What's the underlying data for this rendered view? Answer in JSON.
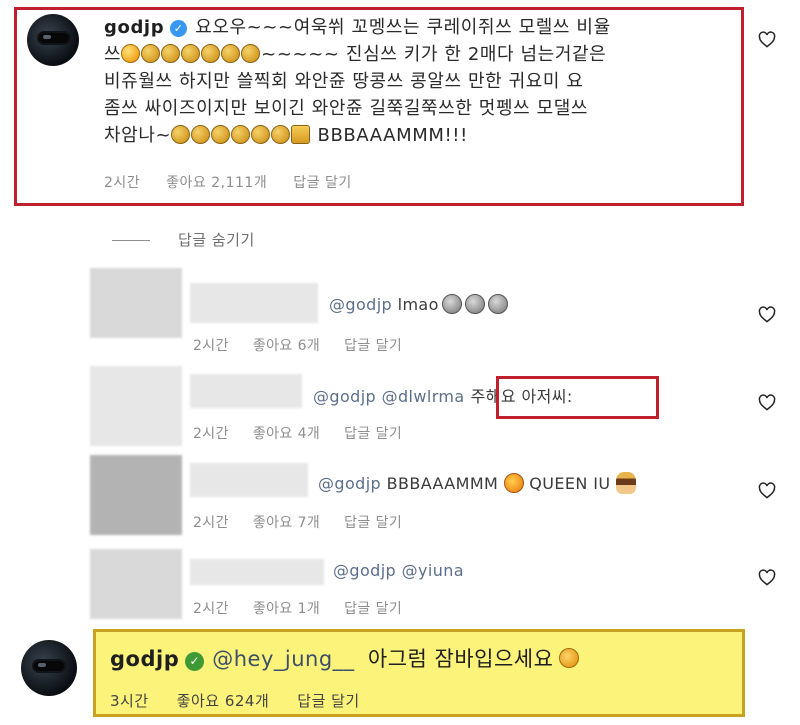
{
  "top_comment": {
    "username": "godjp",
    "line1": "요오우~~~여욱쒸 꼬멩쓰는 쿠레이쥐쓰 모렐쓰 비율",
    "line2_prefix": "쓰",
    "line2_suffix": "~~~~~ 진심쓰 키가 한 2매다 넘는거같은",
    "line3": "비쥬월쓰 하지만 쓸찍회 와안쥰 땅콩쓰 콩알쓰 만한 귀요미 요",
    "line4": "좀쓰 싸이즈이지만 보이긴 와안쥰 길쭉길쭉쓰한 멋펭쓰 모댈쓰",
    "line5_prefix": "차암나~",
    "line5_suffix": "BBBAAAMMM!!!",
    "time": "2시간",
    "likes": "좋아요 2,111개",
    "reply": "답글 달기"
  },
  "hide_replies": "답글 숨기기",
  "replies": [
    {
      "mention": "@godjp",
      "text": " lmao",
      "time": "2시간",
      "likes": "좋아요 6개",
      "reply": "답글 달기"
    },
    {
      "mention": "@godjp @dlwlrma",
      "text": "주해요 아저씨:",
      "time": "2시간",
      "likes": "좋아요 4개",
      "reply": "답글 달기"
    },
    {
      "mention": "@godjp",
      "text": " BBBAAAMMM",
      "text2": "QUEEN IU",
      "time": "2시간",
      "likes": "좋아요 7개",
      "reply": "답글 달기"
    },
    {
      "mention": "@godjp @yiuna",
      "text": "",
      "time": "2시간",
      "likes": "좋아요 1개",
      "reply": "답글 달기"
    }
  ],
  "bottom_comment": {
    "username": "godjp",
    "mention": "@hey_jung__",
    "text": "아그럼 잠바입으세요",
    "time": "3시간",
    "likes": "좋아요 624개",
    "reply": "답글 달기"
  },
  "colors": {
    "highlight_border": "#c01f2d",
    "highlight_fill": "#fbf37a",
    "verified_blue": "#3897f0",
    "verified_green": "#3f9a35"
  },
  "icons": [
    "heart-icon",
    "verified-badge-icon",
    "clap-emoji-icon",
    "astonished-emoji-icon",
    "thumbs-up-emoji-icon",
    "laughing-emoji-icon",
    "star-struck-emoji-icon",
    "queen-emoji-icon",
    "sad-emoji-icon"
  ]
}
